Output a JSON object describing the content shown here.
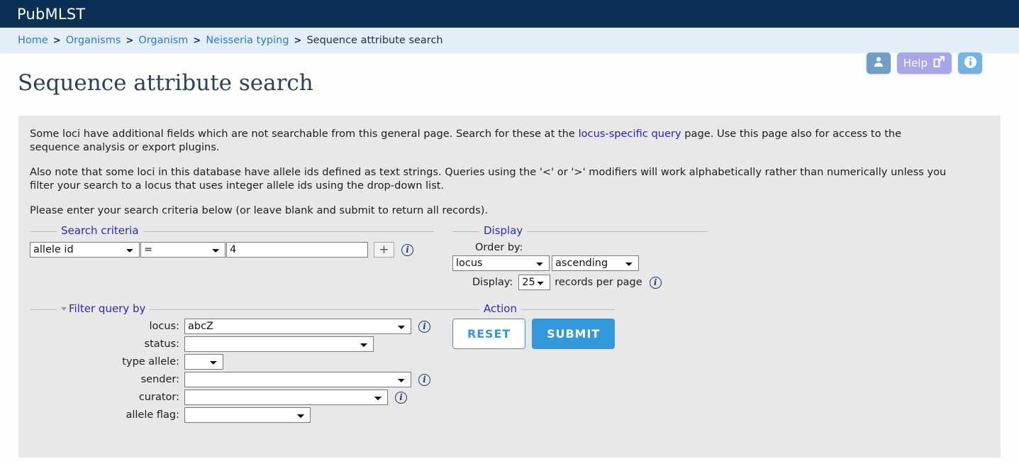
{
  "header": {
    "site_title": "PubMLST"
  },
  "breadcrumb": {
    "items": [
      {
        "label": "Home",
        "current": false
      },
      {
        "label": "Organisms",
        "current": false
      },
      {
        "label": "Organism",
        "current": false
      },
      {
        "label": "Neisseria typing",
        "current": false
      },
      {
        "label": "Sequence attribute search",
        "current": true
      }
    ],
    "separator": ">"
  },
  "top_buttons": {
    "user_icon": "user-icon",
    "help_label": "Help",
    "help_icon": "external-link-icon",
    "info_icon": "info-icon"
  },
  "page": {
    "title": "Sequence attribute search"
  },
  "intro": {
    "p1_before": "Some loci have additional fields which are not searchable from this general page. Search for these at the ",
    "p1_link": "locus-specific query",
    "p1_after": " page. Use this page also for access to the sequence analysis or export plugins.",
    "p2": "Also note that some loci in this database have allele ids defined as text strings. Queries using the '<' or '>' modifiers will work alphabetically rather than numerically unless you filter your search to a locus that uses integer allele ids using the drop-down list.",
    "p3": "Please enter your search criteria below (or leave blank and submit to return all records)."
  },
  "search_criteria": {
    "legend": "Search criteria",
    "field_value": "allele id",
    "operator_value": "=",
    "value": "4",
    "value_placeholder": "",
    "add_button_label": "+",
    "info_icon": "info-icon"
  },
  "display": {
    "legend": "Display",
    "order_by_label": "Order by:",
    "order_by_value": "locus",
    "order_dir_value": "ascending",
    "display_label": "Display:",
    "records_value": "25",
    "records_suffix": "records per page",
    "info_icon": "info-icon"
  },
  "filter": {
    "legend": "Filter query by",
    "rows": [
      {
        "label": "locus:",
        "value": "abcZ",
        "size": "lg",
        "info": true
      },
      {
        "label": "status:",
        "value": "",
        "size": "md",
        "info": false
      },
      {
        "label": "type allele:",
        "value": "",
        "size": "xs",
        "info": false
      },
      {
        "label": "sender:",
        "value": "",
        "size": "lg",
        "info": true
      },
      {
        "label": "curator:",
        "value": "",
        "size": "sm",
        "info": true
      },
      {
        "label": "allele flag:",
        "value": "",
        "size": "flag",
        "info": false
      }
    ]
  },
  "action": {
    "legend": "Action",
    "reset_label": "RESET",
    "submit_label": "SUBMIT"
  },
  "colors": {
    "header_navy": "#0b3056",
    "breadcrumb_bg": "#e3eef8",
    "crumb_link": "#2b7bb9",
    "content_bg": "#e8e8e8",
    "legend_blue": "#2a2ab0",
    "link_blue": "#2222cc",
    "accent_blue": "#3398db",
    "help_purple": "#a8a6e8",
    "user_blue": "#6f9fc4",
    "info_blue": "#6fb3e8",
    "title_navy": "#2b4256"
  }
}
